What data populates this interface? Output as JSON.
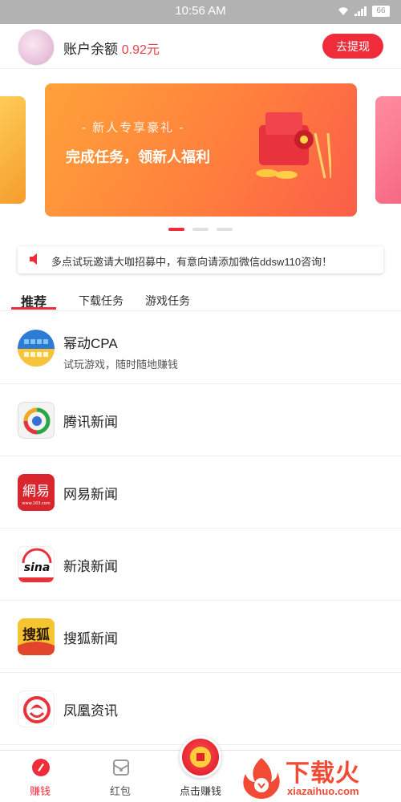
{
  "status_bar": {
    "time": "10:56 AM",
    "battery": "66"
  },
  "account": {
    "label": "账户余额",
    "amount": "0.92元",
    "withdraw_label": "去提现"
  },
  "banner": {
    "subtitle": "- 新人专享豪礼 -",
    "title": "完成任务，领新人福利",
    "page_count": 3,
    "active_page": 1
  },
  "notice": {
    "text": "多点试玩邀请大咖招募中，有意向请添加微信ddsw110咨询！"
  },
  "tabs": [
    {
      "label": "推荐",
      "active": true
    },
    {
      "label": "下载任务",
      "active": false
    },
    {
      "label": "游戏任务",
      "active": false
    }
  ],
  "tasks": [
    {
      "title": "幂动CPA",
      "desc": "试玩游戏，随时随地赚钱",
      "icon": "midong-cpa-icon"
    },
    {
      "title": "腾讯新闻",
      "desc": "",
      "icon": "tencent-news-icon"
    },
    {
      "title": "网易新闻",
      "desc": "",
      "icon": "netease-news-icon"
    },
    {
      "title": "新浪新闻",
      "desc": "",
      "icon": "sina-news-icon"
    },
    {
      "title": "搜狐新闻",
      "desc": "",
      "icon": "sohu-news-icon"
    },
    {
      "title": "凤凰资讯",
      "desc": "",
      "icon": "ifeng-news-icon"
    }
  ],
  "bottom_nav": {
    "earn": "赚钱",
    "red_packet": "红包",
    "click_earn": "点击赚钱"
  },
  "watermark": {
    "brand": "下载火",
    "url": "xiazaihuo.com"
  },
  "icon_texts": {
    "netease": "網易",
    "netease_url": "www.163.com",
    "sina": "sina",
    "sohu": "搜狐"
  },
  "colors": {
    "accent": "#f02c3b",
    "amount": "#e8404a"
  }
}
